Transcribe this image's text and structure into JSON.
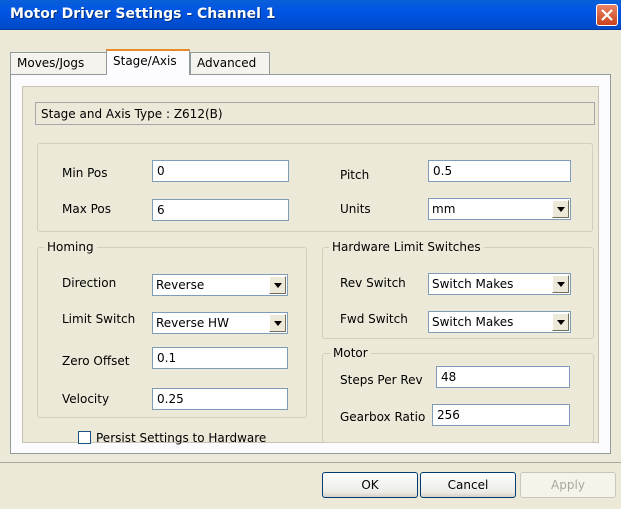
{
  "window": {
    "title": "Motor Driver Settings - Channel 1"
  },
  "tabs": [
    {
      "label": "Moves/Jogs"
    },
    {
      "label": "Stage/Axis"
    },
    {
      "label": "Advanced"
    }
  ],
  "stage": {
    "type_text": "Stage and Axis Type : Z612(B)"
  },
  "limits": {
    "min_pos_label": "Min Pos",
    "min_pos_value": "0",
    "max_pos_label": "Max Pos",
    "max_pos_value": "6",
    "pitch_label": "Pitch",
    "pitch_value": "0.5",
    "units_label": "Units",
    "units_value": "mm"
  },
  "homing": {
    "legend": "Homing",
    "direction_label": "Direction",
    "direction_value": "Reverse",
    "limit_switch_label": "Limit Switch",
    "limit_switch_value": "Reverse HW",
    "zero_offset_label": "Zero Offset",
    "zero_offset_value": "0.1",
    "velocity_label": "Velocity",
    "velocity_value": "0.25"
  },
  "hw_limits": {
    "legend": "Hardware Limit Switches",
    "rev_label": "Rev Switch",
    "rev_value": "Switch Makes",
    "fwd_label": "Fwd Switch",
    "fwd_value": "Switch Makes"
  },
  "motor": {
    "legend": "Motor",
    "steps_label": "Steps Per Rev",
    "steps_value": "48",
    "gearbox_label": "Gearbox Ratio",
    "gearbox_value": "256"
  },
  "persist": {
    "label": "Persist Settings to Hardware",
    "checked": false
  },
  "buttons": {
    "ok": "OK",
    "cancel": "Cancel",
    "apply": "Apply"
  }
}
